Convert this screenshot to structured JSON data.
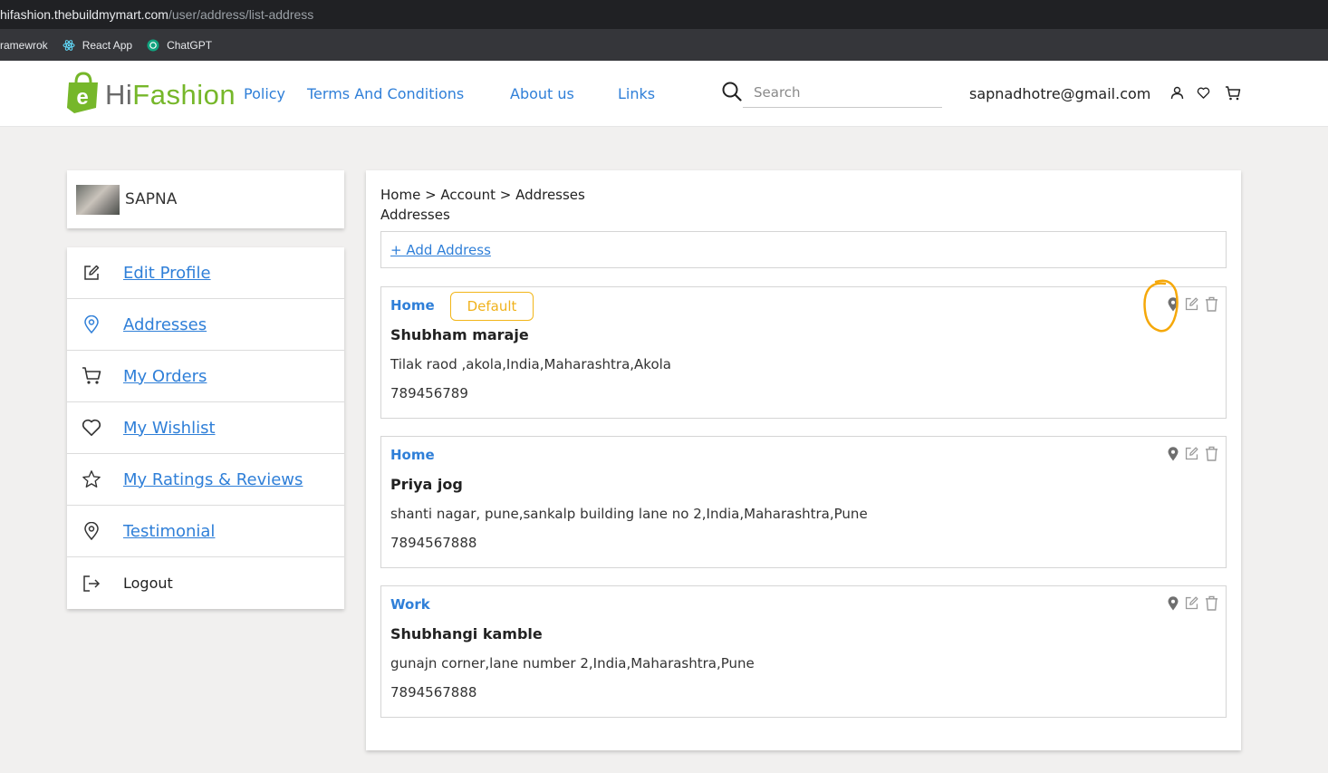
{
  "browser": {
    "url_host": "hifashion.thebuildmymart.com",
    "url_path": "/user/address/list-address",
    "bookmarks": [
      {
        "label": "ramewrok",
        "icon": "folder-icon"
      },
      {
        "label": "React App",
        "icon": "react-icon"
      },
      {
        "label": "ChatGPT",
        "icon": "chatgpt-icon"
      }
    ]
  },
  "header": {
    "logo_hi": "Hi",
    "logo_fashion": "Fashion",
    "nav": [
      "Policy",
      "Terms And Conditions",
      "About us",
      "Links"
    ],
    "search_placeholder": "Search",
    "user_email": "sapnadhotre@gmail.com",
    "icons": [
      "search-icon",
      "user-icon",
      "heart-icon",
      "cart-icon"
    ]
  },
  "profile": {
    "name": "SAPNA"
  },
  "sidebar": {
    "items": [
      {
        "label": "Edit Profile",
        "icon": "edit-icon"
      },
      {
        "label": "Addresses",
        "icon": "location-pin-icon"
      },
      {
        "label": "My Orders",
        "icon": "cart-icon"
      },
      {
        "label": "My Wishlist",
        "icon": "heart-icon"
      },
      {
        "label": "My Ratings & Reviews",
        "icon": "star-icon"
      },
      {
        "label": "Testimonial",
        "icon": "location-pin-icon"
      },
      {
        "label": "Logout",
        "icon": "logout-icon"
      }
    ]
  },
  "main": {
    "breadcrumb": "Home > Account > Addresses",
    "title": "Addresses",
    "add_address": "+ Add Address",
    "addresses": [
      {
        "type": "Home",
        "badge": "Default",
        "name": "Shubham maraje",
        "address": "Tilak raod ,akola,India,Maharashtra,Akola",
        "phone": "789456789"
      },
      {
        "type": "Home",
        "name": "Priya jog",
        "address": "shanti nagar, pune,sankalp building lane no 2,India,Maharashtra,Pune",
        "phone": "7894567888"
      },
      {
        "type": "Work",
        "name": "Shubhangi kamble",
        "address": "gunajn corner,lane number 2,India,Maharashtra,Pune",
        "phone": "7894567888"
      }
    ]
  },
  "colors": {
    "link": "#2f7fd8",
    "brand_green": "#76b72a",
    "badge": "#f0b21c",
    "annotation": "#f5a80a"
  }
}
